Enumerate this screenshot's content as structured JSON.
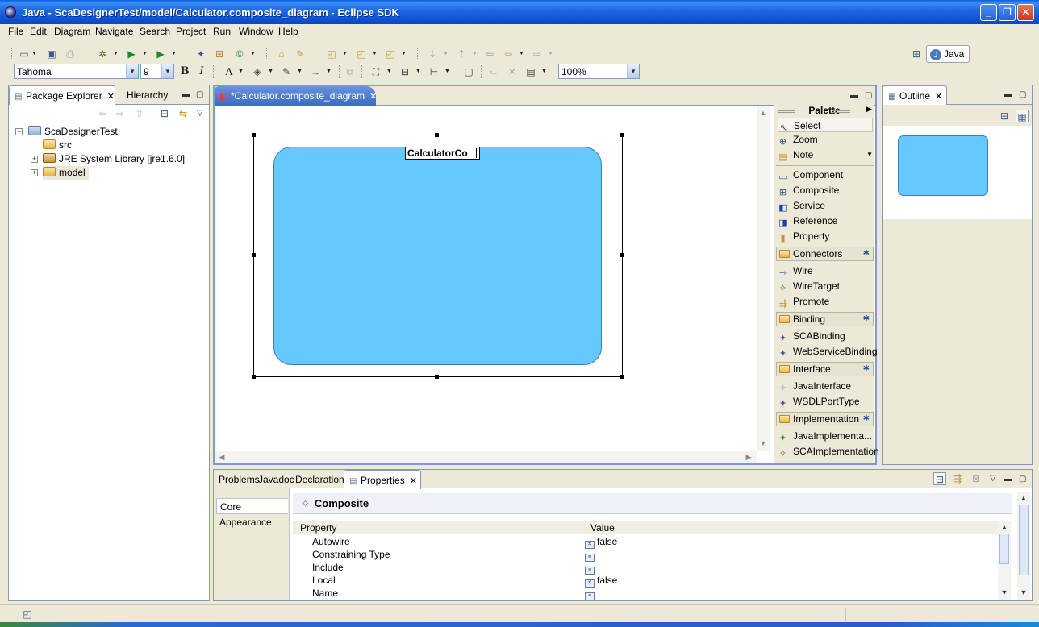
{
  "window": {
    "title": "Java - ScaDesignerTest/model/Calculator.composite_diagram - Eclipse SDK"
  },
  "menu": [
    "File",
    "Edit",
    "Diagram",
    "Navigate",
    "Search",
    "Project",
    "Run",
    "Window",
    "Help"
  ],
  "format_toolbar": {
    "font": "Tahoma",
    "font_size": "9",
    "bold": "B",
    "italic": "I",
    "zoom": "100%"
  },
  "perspective": {
    "label": "Java"
  },
  "package_explorer": {
    "tabs": [
      "Package Explorer",
      "Hierarchy"
    ],
    "tree": [
      {
        "label": "ScaDesignerTest",
        "icon": "project-icon"
      },
      {
        "label": "src",
        "icon": "source-folder-icon"
      },
      {
        "label": "JRE System Library [jre1.6.0]",
        "icon": "library-icon"
      },
      {
        "label": "model",
        "icon": "folder-icon"
      }
    ]
  },
  "editor": {
    "tab_label": "*Calculator.composite_diagram",
    "composite_name_editing": "CalculatorCo",
    "composite_color": "#66c8fb"
  },
  "palette": {
    "title": "Palette",
    "tools": [
      "Select",
      "Zoom",
      "Note"
    ],
    "elements": [
      "Component",
      "Composite",
      "Service",
      "Reference",
      "Property"
    ],
    "drawers": [
      {
        "label": "Connectors",
        "items": [
          "Wire",
          "WireTarget",
          "Promote"
        ]
      },
      {
        "label": "Binding",
        "items": [
          "SCABinding",
          "WebServiceBinding"
        ]
      },
      {
        "label": "Interface",
        "items": [
          "JavaInterface",
          "WSDLPortType"
        ]
      },
      {
        "label": "Implementation",
        "items": [
          "JavaImplementa...",
          "SCAImplementation"
        ]
      }
    ]
  },
  "outline": {
    "tab_label": "Outline"
  },
  "bottom_tabs": [
    "Problems",
    "Javadoc",
    "Declaration",
    "Properties"
  ],
  "properties": {
    "title": "Composite",
    "side_tabs": [
      "Core",
      "Appearance"
    ],
    "columns": [
      "Property",
      "Value"
    ],
    "rows": [
      {
        "key": "Autowire",
        "value": "false"
      },
      {
        "key": "Constraining Type",
        "value": ""
      },
      {
        "key": "Include",
        "value": ""
      },
      {
        "key": "Local",
        "value": "false"
      },
      {
        "key": "Name",
        "value": ""
      }
    ]
  }
}
